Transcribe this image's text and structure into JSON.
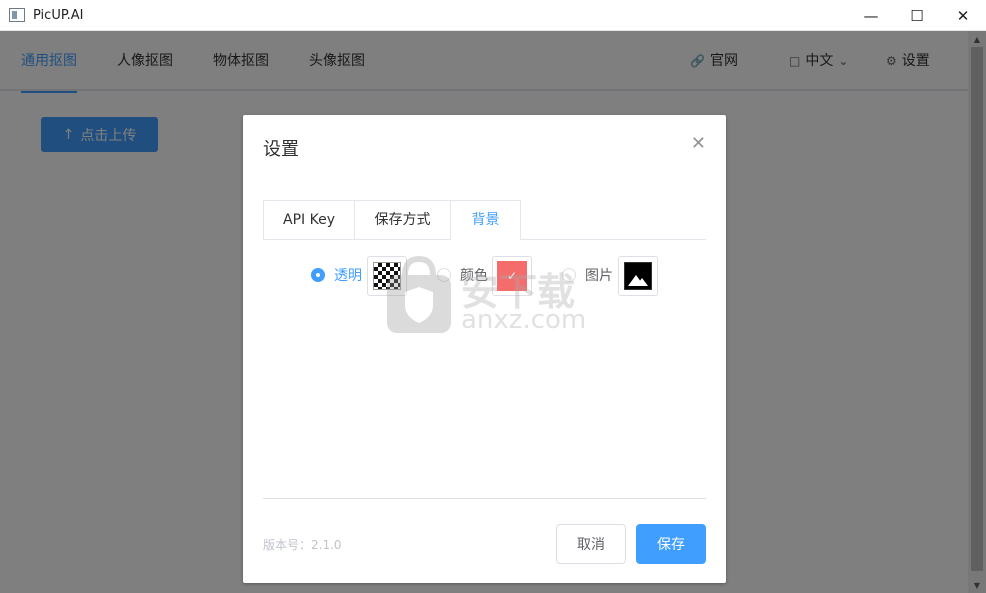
{
  "window": {
    "title": "PicUP.AI",
    "controls": [
      "minimize-icon",
      "maximize-icon",
      "close-icon"
    ]
  },
  "nav": {
    "tabs": [
      {
        "label": "通用抠图",
        "active": true
      },
      {
        "label": "人像抠图",
        "active": false
      },
      {
        "label": "物体抠图",
        "active": false
      },
      {
        "label": "头像抠图",
        "active": false
      }
    ],
    "website": {
      "label": "官网",
      "icon": "link-icon"
    },
    "language": {
      "label": "中文",
      "icon": "chat-icon"
    },
    "settings": {
      "label": "设置",
      "icon": "gear-icon"
    }
  },
  "upload": {
    "label": "点击上传",
    "icon": "upload-icon"
  },
  "dialog": {
    "title": "设置",
    "tabs": [
      {
        "label": "API Key",
        "active": false
      },
      {
        "label": "保存方式",
        "active": false
      },
      {
        "label": "背景",
        "active": true
      }
    ],
    "background_options": [
      {
        "label": "透明",
        "checked": true,
        "swatch": "checkerboard"
      },
      {
        "label": "颜色",
        "checked": false,
        "swatch": "color",
        "color": "#f56c6c"
      },
      {
        "label": "图片",
        "checked": false,
        "swatch": "image"
      }
    ],
    "version": "版本号：2.1.0",
    "cancel_label": "取消",
    "save_label": "保存"
  },
  "watermark": {
    "cn": "安下载",
    "en": "anxz.com"
  },
  "colors": {
    "accent": "#409eff",
    "overlay": "rgba(0,0,0,0.5)",
    "swatch_color": "#f56c6c"
  }
}
